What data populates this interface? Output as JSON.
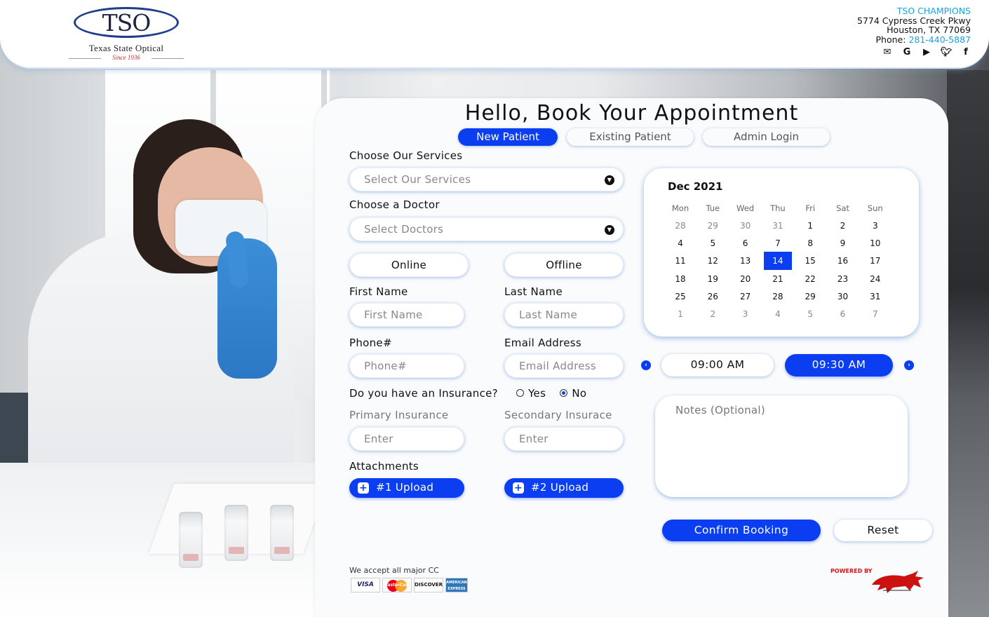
{
  "brand": {
    "logo_text": "TSO",
    "logo_name": "Texas State Optical",
    "logo_since": "Since 1936"
  },
  "contact": {
    "practice": "TSO CHAMPIONS",
    "street": "5774 Cypress Creek Pkwy",
    "city": "Houston, TX 77069",
    "phone_label": "Phone:",
    "phone": "281-440-5887",
    "socials": [
      "email-icon",
      "google-icon",
      "youtube-icon",
      "twitter-icon",
      "facebook-icon"
    ]
  },
  "title": "Hello, Book Your Appointment",
  "tabs": [
    {
      "label": "New Patient",
      "active": true
    },
    {
      "label": "Existing Patient",
      "active": false
    },
    {
      "label": "Admin Login",
      "active": false
    }
  ],
  "form": {
    "services_label": "Choose Our Services",
    "services_placeholder": "Select Our Services",
    "doctor_label": "Choose a Doctor",
    "doctor_placeholder": "Select Doctors",
    "mode_online": "Online",
    "mode_offline": "Offline",
    "first_name_label": "First Name",
    "first_name_placeholder": "First Name",
    "last_name_label": "Last Name",
    "last_name_placeholder": "Last Name",
    "phone_label": "Phone#",
    "phone_placeholder": "Phone#",
    "email_label": "Email Address",
    "email_placeholder": "Email Address",
    "insurance_question": "Do you have an Insurance?",
    "insurance_yes": "Yes",
    "insurance_no": "No",
    "insurance_selected": "No",
    "primary_label": "Primary Insurance",
    "primary_placeholder": "Enter",
    "secondary_label": "Secondary Insurace",
    "secondary_placeholder": "Enter",
    "attachments_label": "Attachments",
    "upload1": "#1 Upload",
    "upload2": "#2 Upload"
  },
  "payments": {
    "text": "We accept all major CC",
    "cards": [
      "VISA",
      "MasterCard",
      "DISCOVER",
      "AMERICAN EXPRESS"
    ]
  },
  "powered_by": "POWERED BY",
  "calendar": {
    "title": "Dec 2021",
    "weekdays": [
      "Mon",
      "Tue",
      "Wed",
      "Thu",
      "Fri",
      "Sat",
      "Sun"
    ],
    "weeks": [
      [
        "28",
        "29",
        "30",
        "31",
        "1",
        "2",
        "3"
      ],
      [
        "4",
        "5",
        "6",
        "7",
        "8",
        "9",
        "10"
      ],
      [
        "11",
        "12",
        "13",
        "14",
        "15",
        "16",
        "17"
      ],
      [
        "18",
        "19",
        "20",
        "21",
        "22",
        "23",
        "24"
      ],
      [
        "25",
        "26",
        "27",
        "28",
        "29",
        "30",
        "31"
      ],
      [
        "1",
        "2",
        "3",
        "4",
        "5",
        "6",
        "7"
      ]
    ],
    "selected": "14"
  },
  "times": {
    "slot1": "09:00 AM",
    "slot2": "09:30 AM",
    "selected": "09:30 AM"
  },
  "notes_placeholder": "Notes (Optional)",
  "buttons": {
    "confirm": "Confirm Booking",
    "reset": "Reset"
  },
  "colors": {
    "accent": "#0a3ef0",
    "link": "#1aa3e0",
    "header_bg": "#ffffff"
  }
}
